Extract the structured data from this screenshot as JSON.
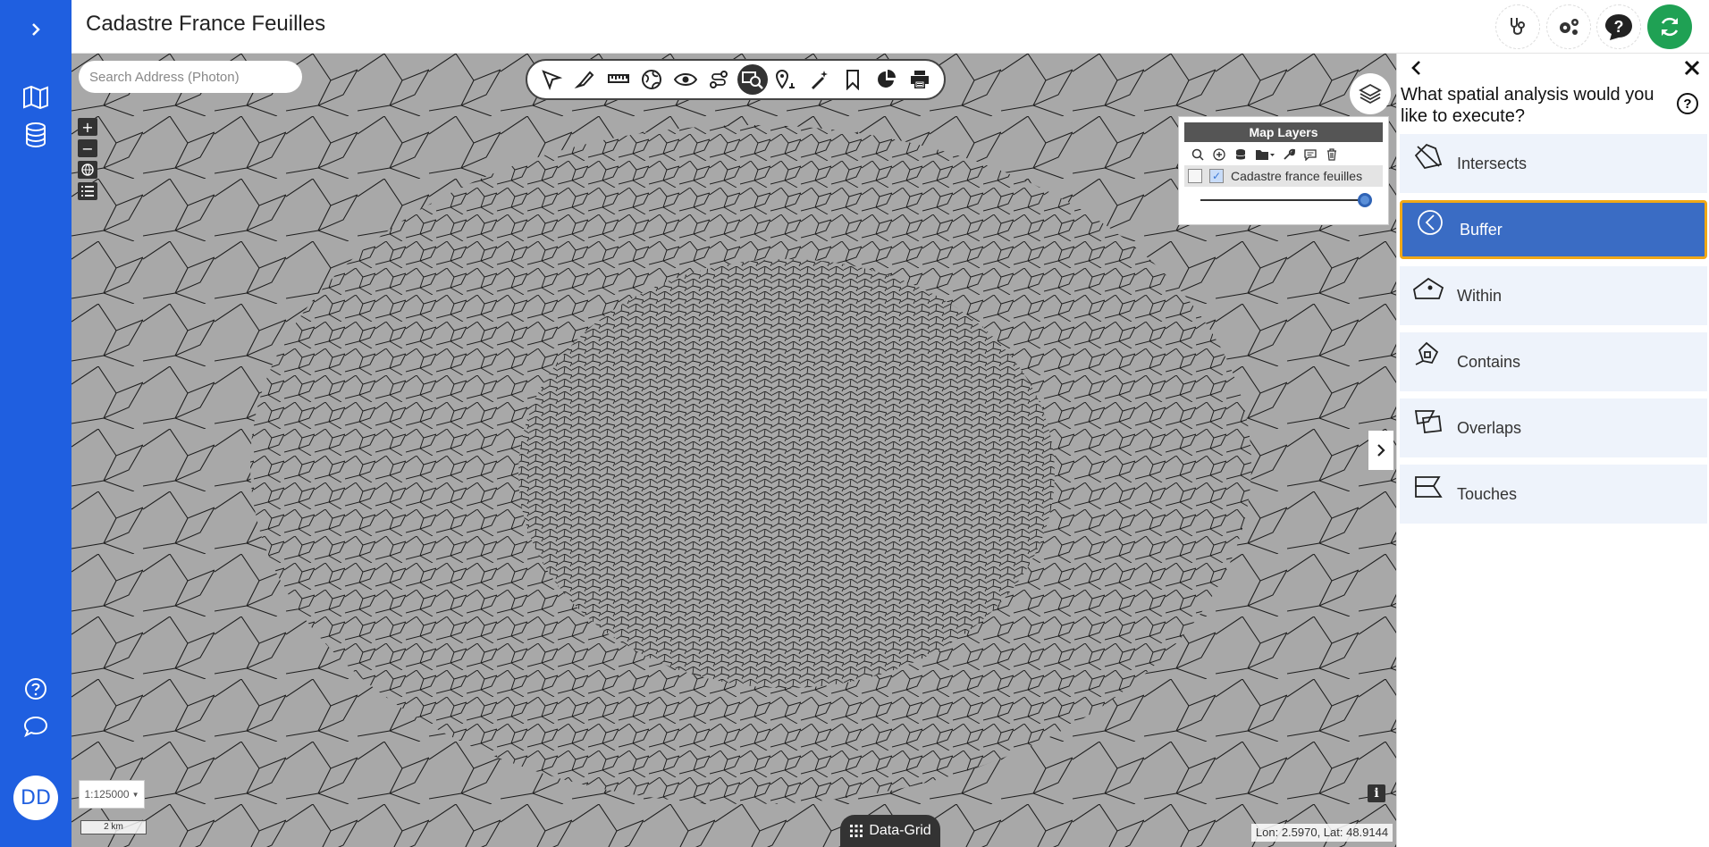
{
  "app": {
    "title": "Cadastre France Feuilles"
  },
  "sidebar": {
    "expand_icon": "chevron-right-icon",
    "items": [
      {
        "name": "map-icon"
      },
      {
        "name": "database-icon"
      }
    ],
    "bottom_items": [
      {
        "name": "help-icon"
      },
      {
        "name": "chat-icon"
      }
    ],
    "avatar_initials": "DD"
  },
  "header": {
    "buttons": [
      {
        "name": "stethoscope-icon"
      },
      {
        "name": "settings-icon"
      },
      {
        "name": "question-icon"
      },
      {
        "name": "refresh-icon",
        "color": "#1fa154"
      }
    ]
  },
  "map": {
    "search_placeholder": "Search Address (Photon)",
    "zoom_controls": [
      "+",
      "−"
    ],
    "toolbar": [
      "select-icon",
      "draw-icon",
      "measure-icon",
      "globe-icon",
      "eye-icon",
      "route-icon",
      "spatial-search-icon",
      "location-pin-icon",
      "magic-wand-icon",
      "bookmark-icon",
      "pie-chart-icon",
      "print-icon"
    ],
    "toolbar_active": "spatial-search-icon",
    "layers_panel": {
      "title": "Map Layers",
      "layer_name": "Cadastre france feuilles",
      "layer_visible": true,
      "opacity": 1.0
    },
    "scale_select": "1:125000",
    "scale_bar": "2 km",
    "data_grid_label": "Data-Grid",
    "coordinates": "Lon: 2.5970, Lat: 48.9144",
    "info_label": "i"
  },
  "panel": {
    "question": "What spatial analysis would you like to execute?",
    "options": [
      {
        "label": "Intersects",
        "icon": "intersects-icon"
      },
      {
        "label": "Buffer",
        "icon": "buffer-icon",
        "selected": true
      },
      {
        "label": "Within",
        "icon": "within-icon"
      },
      {
        "label": "Contains",
        "icon": "contains-icon"
      },
      {
        "label": "Overlaps",
        "icon": "overlaps-icon"
      },
      {
        "label": "Touches",
        "icon": "touches-icon"
      }
    ],
    "accent_color": "#3a6cc4",
    "selection_border": "#f0a817"
  }
}
